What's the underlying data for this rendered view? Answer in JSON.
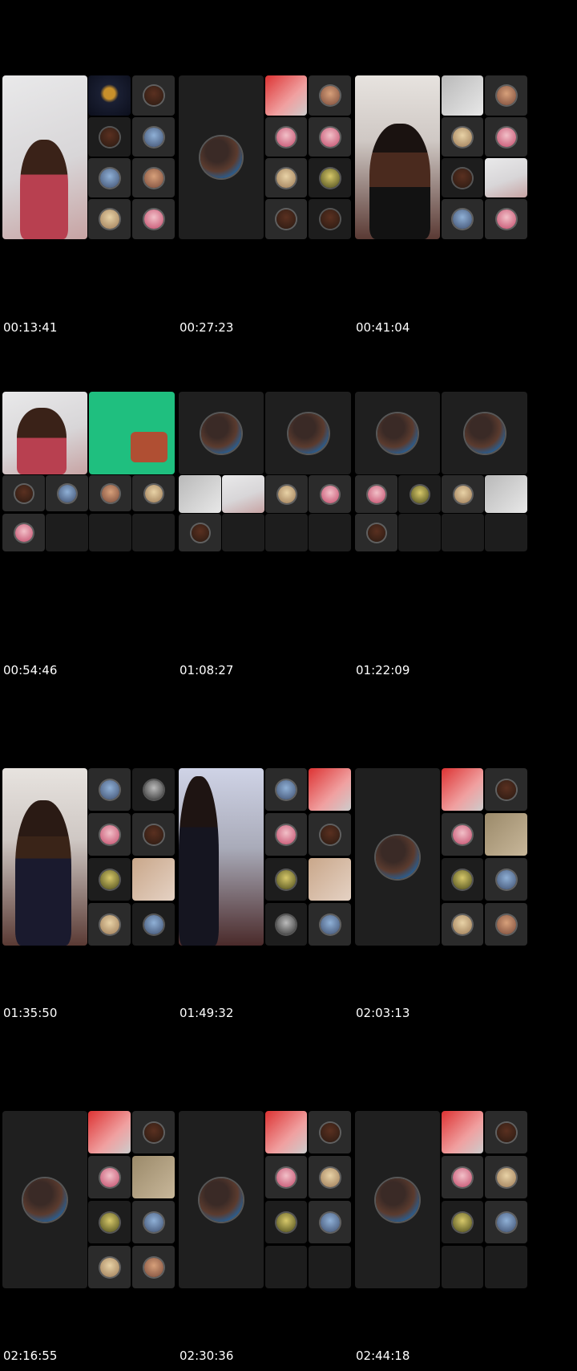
{
  "timestamps": [
    "00:13:41",
    "00:27:23",
    "00:41:04",
    "00:54:46",
    "01:08:27",
    "01:22:09",
    "01:35:50",
    "01:49:32",
    "02:03:13",
    "02:16:55",
    "02:30:36",
    "02:44:18"
  ]
}
